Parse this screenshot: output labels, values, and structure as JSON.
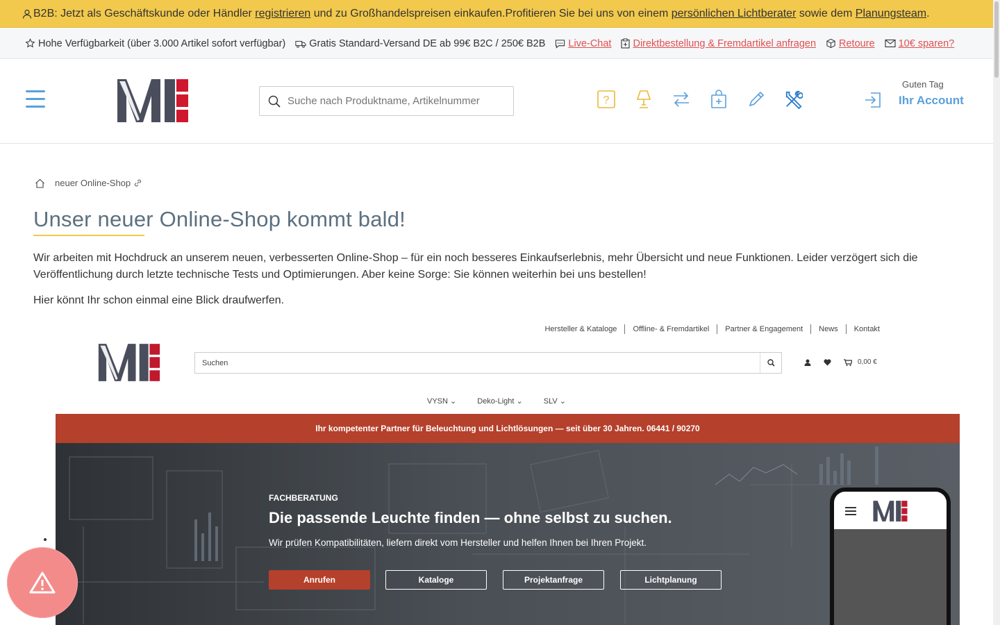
{
  "topbar": {
    "prefix": "B2B: Jetzt als Geschäftskunde oder Händler ",
    "link_register": "registrieren",
    "middle": " und zu Großhandelspreisen einkaufen.Profitieren Sie bei uns von einem ",
    "link_advisor": "persönlichen Lichtberater",
    "middle2": " sowie dem ",
    "link_planning": "Planungsteam",
    "suffix": "."
  },
  "usp": {
    "availability": "Hohe Verfügbarkeit (über 3.000 Artikel sofort verfügbar)",
    "shipping": "Gratis Standard-Versand DE ab 99€ B2C / 250€ B2B",
    "livechat": "Live-Chat",
    "direct_order": "Direktbestellung & Fremdartikel anfragen",
    "return": "Retoure",
    "save": "10€ sparen?"
  },
  "header": {
    "search_placeholder": "Suche nach Produktname, Artikelnummer",
    "icons": [
      "help-icon",
      "lamp-icon",
      "compare-icon",
      "cart-bag-icon",
      "pencil-icon",
      "tools-icon"
    ],
    "greeting": "Guten Tag",
    "account": "Ihr Account"
  },
  "breadcrumb": {
    "current": "neuer Online-Shop"
  },
  "content": {
    "title": "Unser neuer Online-Shop kommt bald!",
    "paragraph": "Wir arbeiten mit Hochdruck an unserem neuen, verbesserten Online-Shop – für ein noch besseres Einkaufserlebnis, mehr Übersicht und neue Funktionen. Leider verzögert sich die Veröffentlichung durch letzte technische Tests und Optimierungen. Aber keine Sorge: Sie können weiterhin bei uns bestellen!",
    "paragraph2": "Hier könnt Ihr schon einmal eine Blick draufwerfen."
  },
  "preview": {
    "nav": [
      "Hersteller & Kataloge",
      "Offline- & Fremdartikel",
      "Partner & Engagement",
      "News",
      "Kontakt"
    ],
    "search_placeholder": "Suchen",
    "cart_total": "0,00 €",
    "menu": [
      "VYSN",
      "Deko-Light",
      "SLV"
    ],
    "banner": "Ihr kompetenter Partner für Beleuchtung und Lichtlösungen — seit über 30 Jahren. 06441 / 90270",
    "hero_tag": "FACHBERATUNG",
    "hero_title": "Die passende Leuchte finden — ohne selbst zu suchen.",
    "hero_sub": "Wir prüfen Kompatibilitäten, liefern direkt vom Hersteller und helfen Ihnen bei Ihren Projekt.",
    "buttons": [
      "Anrufen",
      "Kataloge",
      "Projektanfrage",
      "Lichtplanung"
    ]
  },
  "colors": {
    "topbar": "#f2c94c",
    "accent_blue": "#5aa0dc",
    "link_red": "#e05050",
    "brand_red": "#b5402b",
    "title": "#5c7080"
  }
}
